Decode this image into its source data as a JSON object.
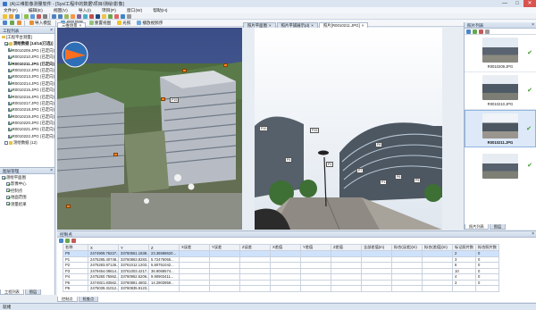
{
  "window": {
    "title": "(A)三维影像测量软件 - [Sys/工程中的数据\\项目/测绘\\影像]",
    "minimize": "—",
    "maximize": "□",
    "close": "✕"
  },
  "menu": [
    "文件(F)",
    "编辑(E)",
    "视图(V)",
    "导入(I)",
    "项目(P)",
    "窗口(W)",
    "帮助(H)"
  ],
  "toolbar2": {
    "import": "导入模型",
    "gallery": "相册管理",
    "resize": "重置视图",
    "light": "光照",
    "playlist": "播放视频序"
  },
  "left_panel": {
    "title": "工程列表",
    "root": "[工程平台测量]",
    "group": "测绘数据 [14/14(已选)]",
    "items": [
      "R0010209.JPG (已定向)",
      "R0010210.JPG (已定向)",
      "R0010211.JPG (已定向)",
      "R0010212.JPG (已定向)",
      "R0010213.JPG (已定向)",
      "R0010214.JPG (已定向)",
      "R0010215.JPG (已定向)",
      "R0010216.JPG (已定向)",
      "R0010217.JPG (已定向)",
      "R0010218.JPG (已定向)",
      "R0010219.JPG (已定向)",
      "R0010220.JPG (已定向)",
      "R0010221.JPG (已定向)",
      "R0010222.JPG (已定向)"
    ],
    "footer_group": "测绘数据 (12)"
  },
  "layer_panel": {
    "title": "图层管理",
    "root": "测绘平面图",
    "items": [
      "影像中心",
      "控制点",
      "地面范围",
      "测量结果"
    ]
  },
  "left_tabs": [
    "工程列表",
    "图层"
  ],
  "view3d": {
    "tab": "三维场景",
    "markers": [
      "P15"
    ]
  },
  "photo_tabs": [
    "照片平面图",
    "照片平铺展示(d)",
    "照片[R0010211.JPG]"
  ],
  "photo_markers": [
    "P10",
    "P15",
    "P4",
    "P8",
    "P2",
    "P1",
    "P6",
    "P5",
    "P7"
  ],
  "right_panel": {
    "title": "照片列表",
    "thumbs": [
      "R0010209.JPG",
      "R0010210.JPG",
      "R0010211.JPG"
    ],
    "tabs": [
      "照片列表",
      "图层"
    ]
  },
  "bottom": {
    "title": "控制点",
    "columns": [
      "名称",
      "X",
      "Y",
      "Z",
      "X误差",
      "Y误差",
      "Z误差",
      "X差值",
      "Y差值",
      "Z差值",
      "全部差值(m)",
      "拟合(误差)(m)",
      "拟合(差值)(m)",
      "标记照片数",
      "拟合照片数"
    ],
    "rows": [
      [
        "P0",
        "2474909.76227...",
        "33760551.1838...",
        "23.36598620...",
        "",
        "",
        "",
        "",
        "",
        "",
        "",
        "",
        "",
        "2",
        "0"
      ],
      [
        "P1",
        "2475285.40748...",
        "33760863.8283...",
        "5.72476055...",
        "",
        "",
        "",
        "",
        "",
        "",
        "",
        "",
        "",
        "3",
        "0"
      ],
      [
        "P2",
        "2475283.87126...",
        "33761012.1203...",
        "5.80751042...",
        "",
        "",
        "",
        "",
        "",
        "",
        "",
        "",
        "",
        "8",
        "0"
      ],
      [
        "P3",
        "2479454.08614...",
        "33761003.4217...",
        "36.9068574...",
        "",
        "",
        "",
        "",
        "",
        "",
        "",
        "",
        "",
        "10",
        "0"
      ],
      [
        "P4",
        "2475260.75562...",
        "33760952.5206...",
        "9.90903411...",
        "",
        "",
        "",
        "",
        "",
        "",
        "",
        "",
        "",
        "4",
        "0"
      ],
      [
        "P5",
        "2474821.83562...",
        "33760881.4802...",
        "14.2903959...",
        "",
        "",
        "",
        "",
        "",
        "",
        "",
        "",
        "",
        "3",
        "0"
      ],
      [
        "P6",
        "2475039.31012...",
        "33760835.9123...",
        "",
        "",
        "",
        "",
        "",
        "",
        "",
        "",
        "",
        "",
        "",
        ""
      ]
    ],
    "tabs": [
      "控制点",
      "检查点"
    ]
  },
  "status": "就绪"
}
